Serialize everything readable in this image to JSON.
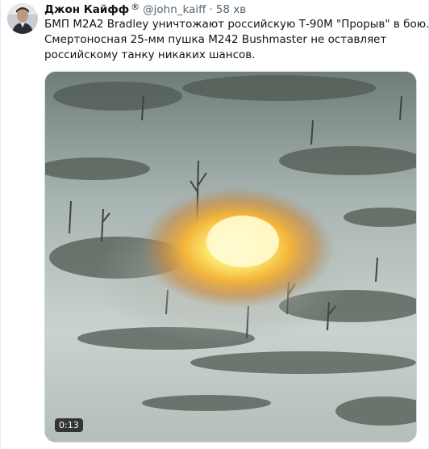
{
  "tweet": {
    "author_name": "Джон Кайфф",
    "author_badge": "®",
    "handle": "@john_kaiff",
    "separator": "·",
    "time": "58 хв",
    "text_lines": [
      "БМП M2A2 Bradley уничтожают российскую Т-90М \"Прорыв\" в бою.",
      "Смертоносная 25-мм пушка M242 Bushmaster не оставляет",
      "российскому танку никаких шансов."
    ],
    "media": {
      "duration": "0:13"
    }
  },
  "colors": {
    "text_primary": "#0f1419",
    "text_secondary": "#536471",
    "border": "#cfd9de"
  },
  "icons": {
    "avatar": "user-avatar-photo",
    "video": "video-thumbnail"
  }
}
